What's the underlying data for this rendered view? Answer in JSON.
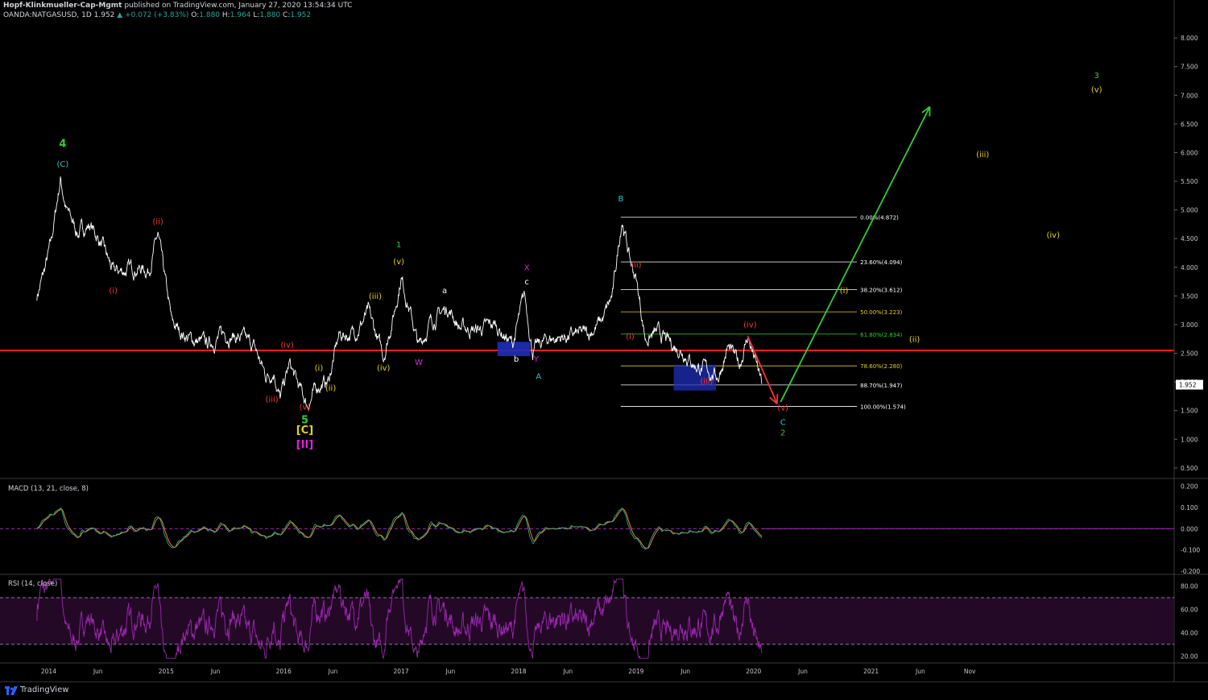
{
  "header": {
    "publisher": "Hopf-Klinkmueller-Cap-Mgmt",
    "published_text": "published on TradingView.com, January 27, 2020 13:54:34 UTC",
    "symbol": "OANDA:NATGASUSD, 1D",
    "last": "1.952",
    "change": "+0.072 (+3.83%)",
    "o_label": "O:",
    "o_val": "1.880",
    "h_label": "H:",
    "h_val": "1.964",
    "l_label": "L:",
    "l_val": "1.880",
    "c_label": "C:",
    "c_val": "1.952"
  },
  "indicators": {
    "macd_label": "MACD (13, 21, close, 8)",
    "rsi_label": "RSI (14, close)"
  },
  "footer": {
    "brand": "TradingView"
  },
  "colors": {
    "background": "#000000",
    "price": "#ffffff",
    "support_line": "#ff1a1a",
    "macd": "#26a69a",
    "signal": "#ff9800",
    "rsi": "#9c27b0",
    "green": "#33cc33",
    "yellow": "#e6d21a",
    "red": "#ff3333",
    "cyan": "#2ec4c4",
    "magenta": "#e01fe0",
    "white": "#ffffff"
  },
  "chart_data": [
    {
      "type": "line",
      "title": "OANDA:NATGASUSD, 1D",
      "y_axis_ticks": [
        "0.500",
        "1.000",
        "1.500",
        "2.000",
        "2.500",
        "3.000",
        "3.500",
        "4.000",
        "4.500",
        "5.000",
        "5.500",
        "6.000",
        "6.500",
        "7.000",
        "7.500",
        "8.000"
      ],
      "ylim": [
        0.5,
        8.0
      ],
      "x_axis_ticks": [
        "2014",
        "Jun",
        "2015",
        "Jun",
        "2016",
        "Jun",
        "2017",
        "Jun",
        "2018",
        "Jun",
        "2019",
        "Jun",
        "2020",
        "Jun",
        "2021",
        "Jun",
        "Nov"
      ],
      "last_price_label": "1.952",
      "price_anchors": [
        [
          2013.9,
          3.5
        ],
        [
          2013.96,
          3.9
        ],
        [
          2014.02,
          4.4
        ],
        [
          2014.1,
          5.55
        ],
        [
          2014.15,
          5.0
        ],
        [
          2014.25,
          4.6
        ],
        [
          2014.35,
          4.75
        ],
        [
          2014.45,
          4.4
        ],
        [
          2014.55,
          3.9
        ],
        [
          2014.65,
          3.95
        ],
        [
          2014.75,
          4.0
        ],
        [
          2014.85,
          3.95
        ],
        [
          2014.93,
          4.55
        ],
        [
          2014.98,
          3.9
        ],
        [
          2015.05,
          3.0
        ],
        [
          2015.2,
          2.75
        ],
        [
          2015.35,
          2.65
        ],
        [
          2015.5,
          2.85
        ],
        [
          2015.65,
          2.75
        ],
        [
          2015.75,
          2.6
        ],
        [
          2015.85,
          2.1
        ],
        [
          2015.92,
          2.2
        ],
        [
          2015.97,
          1.7
        ],
        [
          2016.05,
          2.3
        ],
        [
          2016.12,
          1.95
        ],
        [
          2016.2,
          1.6
        ],
        [
          2016.3,
          1.95
        ],
        [
          2016.38,
          2.0
        ],
        [
          2016.47,
          2.8
        ],
        [
          2016.6,
          2.85
        ],
        [
          2016.72,
          3.2
        ],
        [
          2016.85,
          2.45
        ],
        [
          2016.95,
          3.3
        ],
        [
          2017.0,
          3.85
        ],
        [
          2017.08,
          3.2
        ],
        [
          2017.15,
          2.6
        ],
        [
          2017.25,
          3.05
        ],
        [
          2017.4,
          3.3
        ],
        [
          2017.5,
          2.95
        ],
        [
          2017.65,
          2.9
        ],
        [
          2017.8,
          3.0
        ],
        [
          2017.95,
          2.65
        ],
        [
          2018.05,
          3.5
        ],
        [
          2018.12,
          2.55
        ],
        [
          2018.25,
          2.75
        ],
        [
          2018.45,
          2.8
        ],
        [
          2018.6,
          2.85
        ],
        [
          2018.72,
          3.1
        ],
        [
          2018.8,
          3.5
        ],
        [
          2018.88,
          4.87
        ],
        [
          2018.95,
          4.1
        ],
        [
          2019.0,
          3.8
        ],
        [
          2019.08,
          2.75
        ],
        [
          2019.18,
          2.85
        ],
        [
          2019.3,
          2.65
        ],
        [
          2019.4,
          2.55
        ],
        [
          2019.5,
          2.3
        ],
        [
          2019.6,
          2.2
        ],
        [
          2019.7,
          2.1
        ],
        [
          2019.78,
          2.6
        ],
        [
          2019.88,
          2.3
        ],
        [
          2019.95,
          2.8
        ],
        [
          2020.03,
          2.25
        ],
        [
          2020.07,
          1.95
        ]
      ],
      "support_line_value": 2.55,
      "fibonacci_levels": [
        {
          "label": "0.00%(4.872)",
          "value": 4.872
        },
        {
          "label": "23.60%(4.094)",
          "value": 4.094
        },
        {
          "label": "38.20%(3.612)",
          "value": 3.612
        },
        {
          "label": "50.00%(3.223)",
          "value": 3.223
        },
        {
          "label": "61.80%(2.834)",
          "value": 2.834
        },
        {
          "label": "78.60%(2.280)",
          "value": 2.28
        },
        {
          "label": "88.70%(1.947)",
          "value": 1.947
        },
        {
          "label": "100.00%(1.574)",
          "value": 1.574
        }
      ],
      "projection_arrow_green": {
        "from": [
          2020.23,
          1.65
        ],
        "to": [
          2021.5,
          6.8
        ]
      },
      "projection_arrow_red": {
        "from": [
          2019.95,
          2.8
        ],
        "to": [
          2020.2,
          1.62
        ]
      },
      "annotations": [
        {
          "text": "4",
          "x": 2014.12,
          "y": 6.1,
          "color": "green"
        },
        {
          "text": "(C)",
          "x": 2014.12,
          "y": 5.75,
          "color": "cyan"
        },
        {
          "text": "(ii)",
          "x": 2014.93,
          "y": 4.75,
          "color": "red"
        },
        {
          "text": "(i)",
          "x": 2014.55,
          "y": 3.55,
          "color": "red"
        },
        {
          "text": "(iv)",
          "x": 2016.03,
          "y": 2.6,
          "color": "red"
        },
        {
          "text": "(iii)",
          "x": 2015.9,
          "y": 1.65,
          "color": "red"
        },
        {
          "text": "(v)",
          "x": 2016.18,
          "y": 1.52,
          "color": "red"
        },
        {
          "text": "5",
          "x": 2016.18,
          "y": 1.28,
          "color": "green"
        },
        {
          "text": "[C]",
          "x": 2016.18,
          "y": 1.1,
          "color": "yellow"
        },
        {
          "text": "[II]",
          "x": 2016.18,
          "y": 0.85,
          "color": "magenta"
        },
        {
          "text": "(i)",
          "x": 2016.3,
          "y": 2.2,
          "color": "yellow"
        },
        {
          "text": "(ii)",
          "x": 2016.4,
          "y": 1.85,
          "color": "yellow"
        },
        {
          "text": "(iii)",
          "x": 2016.78,
          "y": 3.45,
          "color": "yellow"
        },
        {
          "text": "(iv)",
          "x": 2016.85,
          "y": 2.2,
          "color": "yellow"
        },
        {
          "text": "1",
          "x": 2016.98,
          "y": 4.35,
          "color": "green"
        },
        {
          "text": "(v)",
          "x": 2016.98,
          "y": 4.05,
          "color": "yellow"
        },
        {
          "text": "W",
          "x": 2017.15,
          "y": 2.3,
          "color": "magenta"
        },
        {
          "text": "a",
          "x": 2017.37,
          "y": 3.55,
          "color": "white"
        },
        {
          "text": "b",
          "x": 2017.98,
          "y": 2.35,
          "color": "white"
        },
        {
          "text": "X",
          "x": 2018.07,
          "y": 3.95,
          "color": "magenta"
        },
        {
          "text": "c",
          "x": 2018.07,
          "y": 3.7,
          "color": "white"
        },
        {
          "text": "Y",
          "x": 2018.15,
          "y": 2.35,
          "color": "magenta"
        },
        {
          "text": "A",
          "x": 2018.17,
          "y": 2.05,
          "color": "cyan"
        },
        {
          "text": "B",
          "x": 2018.87,
          "y": 5.15,
          "color": "cyan"
        },
        {
          "text": "(ii)",
          "x": 2019.0,
          "y": 4.0,
          "color": "red"
        },
        {
          "text": "(i)",
          "x": 2018.95,
          "y": 2.75,
          "color": "red"
        },
        {
          "text": "(iii)",
          "x": 2019.6,
          "y": 1.97,
          "color": "red"
        },
        {
          "text": "(iv)",
          "x": 2019.97,
          "y": 2.95,
          "color": "red"
        },
        {
          "text": "(v)",
          "x": 2020.25,
          "y": 1.5,
          "color": "red"
        },
        {
          "text": "C",
          "x": 2020.25,
          "y": 1.25,
          "color": "cyan"
        },
        {
          "text": "2",
          "x": 2020.25,
          "y": 1.07,
          "color": "green"
        },
        {
          "text": "(i)",
          "x": 2020.77,
          "y": 3.55,
          "color": "yellow"
        },
        {
          "text": "(ii)",
          "x": 2021.37,
          "y": 2.7,
          "color": "yellow"
        },
        {
          "text": "(iii)",
          "x": 2021.95,
          "y": 5.92,
          "color": "yellow"
        },
        {
          "text": "(iv)",
          "x": 2022.55,
          "y": 4.52,
          "color": "yellow"
        },
        {
          "text": "3",
          "x": 2022.92,
          "y": 7.3,
          "color": "green"
        },
        {
          "text": "(v)",
          "x": 2022.92,
          "y": 7.05,
          "color": "yellow"
        }
      ]
    },
    {
      "type": "line",
      "title": "MACD (13, 21, close, 8)",
      "y_axis_ticks": [
        "-0.200",
        "-0.100",
        "0.000",
        "0.100",
        "0.200"
      ],
      "ylim": [
        -0.2,
        0.22
      ]
    },
    {
      "type": "line",
      "title": "RSI (14, close)",
      "y_axis_ticks": [
        "20.00",
        "40.00",
        "60.00",
        "80.00"
      ],
      "ylim": [
        15,
        88
      ],
      "band": [
        30,
        70
      ]
    }
  ]
}
